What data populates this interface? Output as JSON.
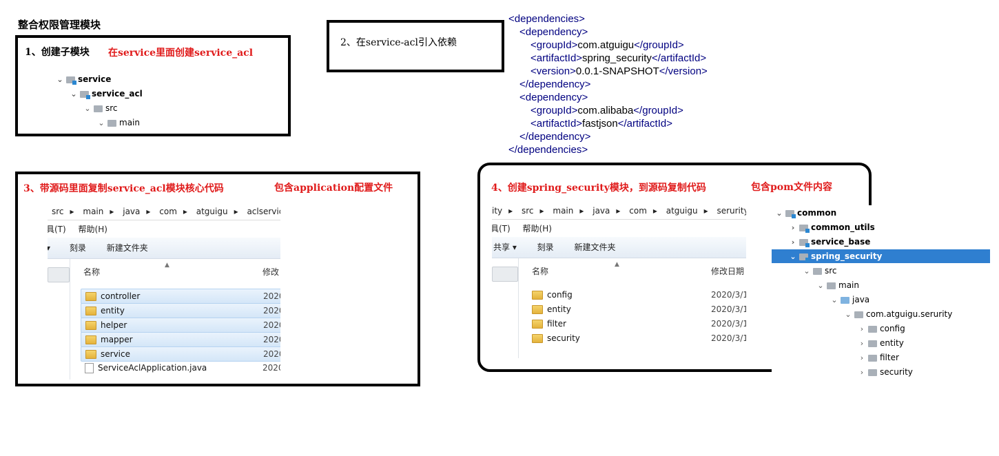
{
  "page_title": "整合权限管理模块",
  "step1": {
    "label": "1、创建子模块",
    "note": "在service里面创建service_acl",
    "tree": [
      {
        "label": "service",
        "bold": true
      },
      {
        "label": "service_acl",
        "bold": true
      },
      {
        "label": "src",
        "bold": false
      },
      {
        "label": "main",
        "bold": false
      }
    ]
  },
  "step2": {
    "label": "2、在service-acl引入依赖"
  },
  "pom": {
    "lines": [
      {
        "tag_open": "<dependencies>",
        "value": "",
        "tag_close": ""
      },
      {
        "tag_open": "<dependency>",
        "value": "",
        "tag_close": ""
      },
      {
        "tag_open": "<groupId>",
        "value": "com.atguigu",
        "tag_close": "</groupId>"
      },
      {
        "tag_open": "<artifactId>",
        "value": "spring_security",
        "tag_close": "</artifactId>"
      },
      {
        "tag_open": "<version>",
        "value": "0.0.1-SNAPSHOT",
        "tag_close": "</version>"
      },
      {
        "tag_open": "</dependency>",
        "value": "",
        "tag_close": ""
      },
      {
        "tag_open": "<dependency>",
        "value": "",
        "tag_close": ""
      },
      {
        "tag_open": "<groupId>",
        "value": "com.alibaba",
        "tag_close": "</groupId>"
      },
      {
        "tag_open": "<artifactId>",
        "value": "fastjson",
        "tag_close": "</artifactId>"
      },
      {
        "tag_open": "</dependency>",
        "value": "",
        "tag_close": ""
      },
      {
        "tag_open": "</dependencies>",
        "value": "",
        "tag_close": ""
      }
    ]
  },
  "step3": {
    "label": "3、带源码里面复制service_acl模块核心代码",
    "note": "包含application配置文件",
    "explorer": {
      "path": [
        "src",
        "main",
        "java",
        "com",
        "atguigu",
        "aclservice"
      ],
      "menu": [
        "具(T)",
        "帮助(H)"
      ],
      "toolbar": [
        "刻录",
        "新建文件夹"
      ],
      "col_name": "名称",
      "col_modified": "修改",
      "files": [
        {
          "name": "controller",
          "date": "2020",
          "type": "folder"
        },
        {
          "name": "entity",
          "date": "2020",
          "type": "folder"
        },
        {
          "name": "helper",
          "date": "2020",
          "type": "folder"
        },
        {
          "name": "mapper",
          "date": "2020",
          "type": "folder"
        },
        {
          "name": "service",
          "date": "2020",
          "type": "folder"
        },
        {
          "name": "ServiceAclApplication.java",
          "date": "2020",
          "type": "file"
        }
      ]
    }
  },
  "step4": {
    "label": "4、创建spring_security模块，到源码复制代码",
    "note": "包含pom文件内容",
    "explorer": {
      "path": [
        "ity",
        "src",
        "main",
        "java",
        "com",
        "atguigu",
        "serurity"
      ],
      "menu": [
        "具(T)",
        "帮助(H)"
      ],
      "toolbar": [
        "共享 ▾",
        "刻录",
        "新建文件夹"
      ],
      "col_name": "名称",
      "col_modified": "修改日期",
      "files": [
        {
          "name": "config",
          "date": "2020/3/1"
        },
        {
          "name": "entity",
          "date": "2020/3/1"
        },
        {
          "name": "filter",
          "date": "2020/3/1"
        },
        {
          "name": "security",
          "date": "2020/3/1"
        }
      ]
    },
    "tree": [
      {
        "label": "common",
        "depth": 0,
        "chev": "⌄",
        "bold": true
      },
      {
        "label": "common_utils",
        "depth": 1,
        "chev": "›",
        "bold": true
      },
      {
        "label": "service_base",
        "depth": 1,
        "chev": "›",
        "bold": true
      },
      {
        "label": "spring_security",
        "depth": 1,
        "chev": "⌄",
        "bold": true,
        "selected": true
      },
      {
        "label": "src",
        "depth": 2,
        "chev": "⌄",
        "bold": false
      },
      {
        "label": "main",
        "depth": 3,
        "chev": "⌄",
        "bold": false
      },
      {
        "label": "java",
        "depth": 4,
        "chev": "⌄",
        "bold": false
      },
      {
        "label": "com.atguigu.serurity",
        "depth": 5,
        "chev": "⌄",
        "bold": false
      },
      {
        "label": "config",
        "depth": 6,
        "chev": "›",
        "bold": false
      },
      {
        "label": "entity",
        "depth": 6,
        "chev": "›",
        "bold": false
      },
      {
        "label": "filter",
        "depth": 6,
        "chev": "›",
        "bold": false
      },
      {
        "label": "security",
        "depth": 6,
        "chev": "›",
        "bold": false
      }
    ]
  },
  "colors": {
    "accent_red": "#e01b1b",
    "xml_tag": "#000080",
    "selection": "#2f7fd0"
  }
}
